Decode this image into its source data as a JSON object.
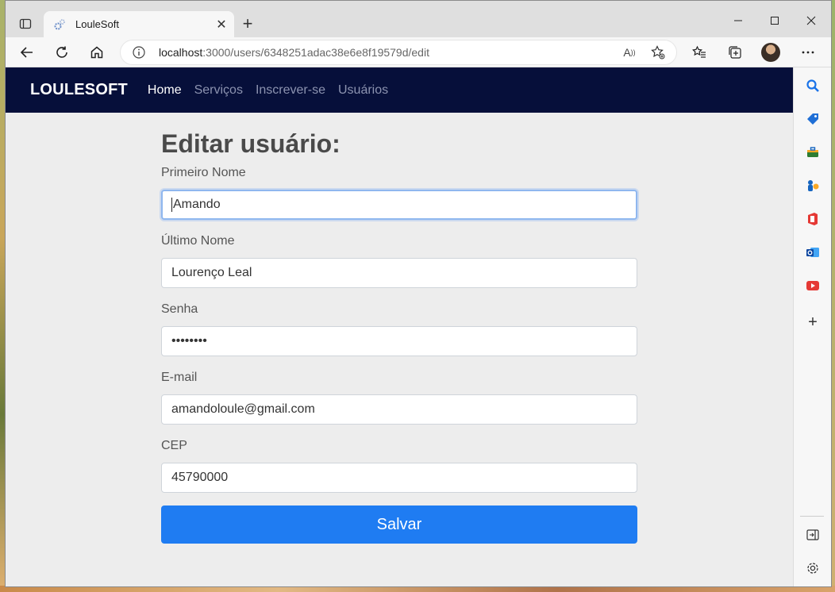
{
  "browser": {
    "tab_title": "LouleSoft",
    "url_host": "localhost",
    "url_path": ":3000/users/6348251adac38e6e8f19579d/edit"
  },
  "navbar": {
    "brand": "LOULESOFT",
    "links": [
      {
        "label": "Home",
        "active": true
      },
      {
        "label": "Serviços",
        "active": false
      },
      {
        "label": "Inscrever-se",
        "active": false
      },
      {
        "label": "Usuários",
        "active": false
      }
    ]
  },
  "form": {
    "title": "Editar usuário:",
    "first_name": {
      "label": "Primeiro Nome",
      "value": "Amando"
    },
    "last_name": {
      "label": "Último Nome",
      "value": "Lourenço Leal"
    },
    "password": {
      "label": "Senha",
      "value": "••••••••"
    },
    "email": {
      "label": "E-mail",
      "value": "amandoloule@gmail.com"
    },
    "cep": {
      "label": "CEP",
      "value": "45790000"
    },
    "submit_label": "Salvar"
  },
  "colors": {
    "navbar_bg": "#060f3a",
    "button_bg": "#1f7cf2",
    "page_bg": "#ededed"
  },
  "icons": {
    "tab_actions": "tab-actions-icon",
    "favicon": "gear-favicon-icon",
    "back": "back-arrow-icon",
    "refresh": "refresh-icon",
    "home": "home-icon",
    "info": "info-icon",
    "read_aloud": "read-aloud-icon",
    "add_favorite": "add-favorite-icon",
    "favorites": "favorites-icon",
    "collections": "collections-icon",
    "more": "more-icon"
  }
}
